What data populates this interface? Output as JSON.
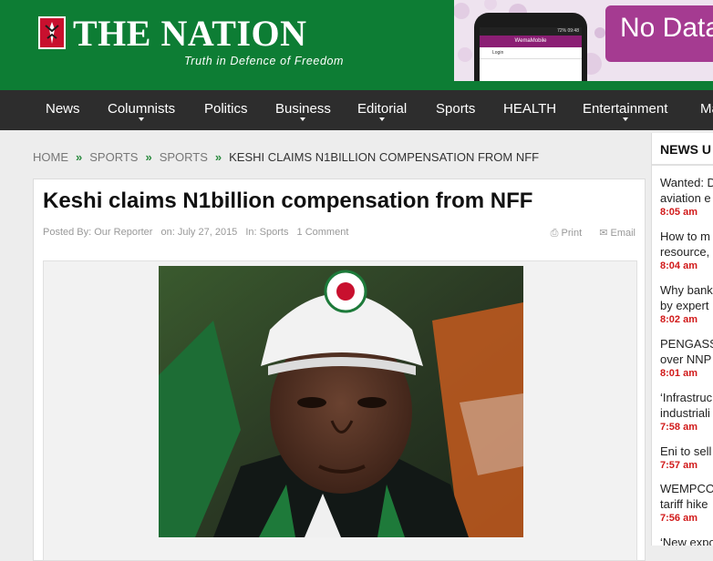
{
  "header": {
    "site_name": "THE NATION",
    "tagline": "Truth in Defence of Freedom"
  },
  "ad": {
    "headline": "No Data",
    "phone_app": "WemaMobile",
    "phone_login": "Login",
    "phone_status": "72% 09:48"
  },
  "nav": {
    "items": [
      "News",
      "Columnists",
      "Politics",
      "Business",
      "Editorial",
      "Sports",
      "HEALTH",
      "Entertainment",
      "Ma"
    ]
  },
  "breadcrumb": {
    "items": [
      "HOME",
      "SPORTS",
      "SPORTS",
      "KESHI CLAIMS N1BILLION COMPENSATION FROM NFF"
    ]
  },
  "article": {
    "title": "Keshi claims N1billion compensation from NFF",
    "posted_by": "Posted By: Our Reporter",
    "date": "on: July 27, 2015",
    "category": "In: Sports",
    "comments": "1 Comment",
    "print_label": "Print",
    "email_label": "Email"
  },
  "sidebar": {
    "heading": "NEWS U",
    "items": [
      {
        "line1": "Wanted: D",
        "line2": "aviation e",
        "time": "8:05 am"
      },
      {
        "line1": "How to m",
        "line2": "resource,",
        "time": "8:04 am"
      },
      {
        "line1": "Why bank",
        "line2": "by expert",
        "time": "8:02 am"
      },
      {
        "line1": "PENGASSA",
        "line2": "over NNP",
        "time": "8:01 am"
      },
      {
        "line1": "‘Infrastruc",
        "line2": "industriali",
        "time": "7:58 am"
      },
      {
        "line1": "Eni to sell",
        "line2": "",
        "time": "7:57 am"
      },
      {
        "line1": "WEMPCO",
        "line2": "tariff hike",
        "time": "7:56 am"
      },
      {
        "line1": "‘New expo",
        "line2": "",
        "time": ""
      }
    ]
  },
  "colors": {
    "header_green": "#0d7d34",
    "nav_bg": "#2d2d2d",
    "accent_red": "#d11a1a",
    "ad_purple": "#a53b91"
  }
}
